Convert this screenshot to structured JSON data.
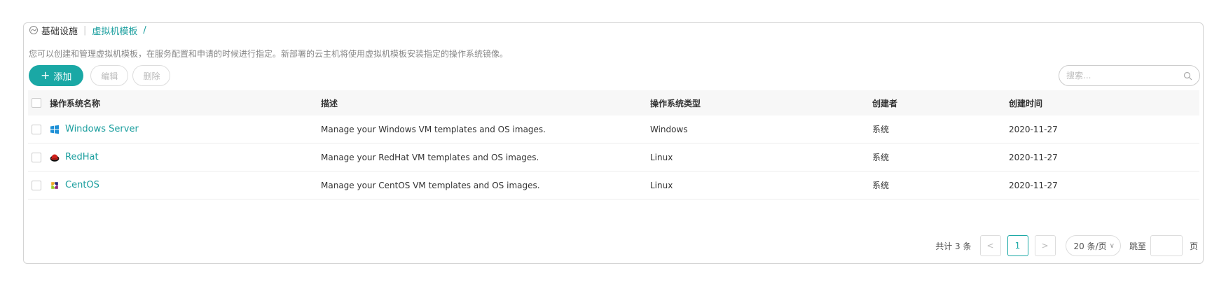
{
  "breadcrumb": {
    "root": "基础设施",
    "current": "虚拟机模板",
    "trailing": "/"
  },
  "description": "您可以创建和管理虚拟机模板，在服务配置和申请的时候进行指定。新部署的云主机将使用虚拟机模板安装指定的操作系统镜像。",
  "toolbar": {
    "add_label": "添加",
    "edit_label": "编辑",
    "delete_label": "删除"
  },
  "search": {
    "placeholder": "搜索..."
  },
  "table": {
    "headers": {
      "name": "操作系统名称",
      "desc": "描述",
      "type": "操作系统类型",
      "creator": "创建者",
      "time": "创建时间"
    },
    "rows": [
      {
        "name": "Windows Server",
        "desc": "Manage your Windows VM templates and OS images.",
        "type": "Windows",
        "creator": "系统",
        "time": "2020-11-27",
        "icon": "windows-icon"
      },
      {
        "name": "RedHat",
        "desc": "Manage your RedHat VM templates and OS images.",
        "type": "Linux",
        "creator": "系统",
        "time": "2020-11-27",
        "icon": "redhat-icon"
      },
      {
        "name": "CentOS",
        "desc": "Manage your CentOS VM templates and OS images.",
        "type": "Linux",
        "creator": "系统",
        "time": "2020-11-27",
        "icon": "centos-icon"
      }
    ]
  },
  "pagination": {
    "total_text": "共计 3 条",
    "prev": "<",
    "current_page": "1",
    "next": ">",
    "page_size": "20 条/页",
    "jump_label": "跳至",
    "page_suffix": "页"
  },
  "colors": {
    "accent": "#1aa8a5"
  }
}
